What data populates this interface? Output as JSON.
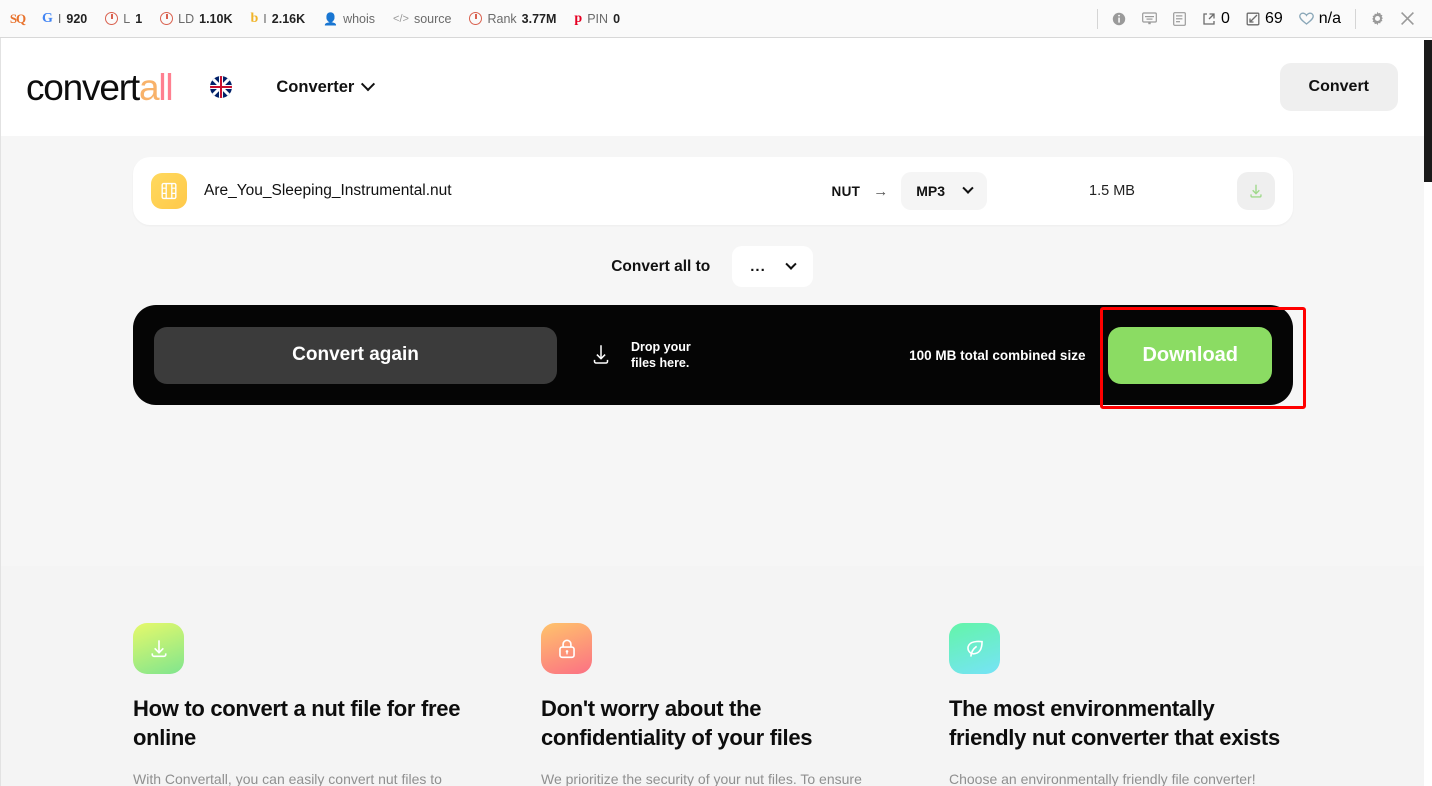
{
  "extension_toolbar": {
    "logo_text": "SQ",
    "metrics": [
      {
        "icon": "google-icon",
        "glyph": "G",
        "label": "I",
        "value": "920"
      },
      {
        "icon": "semrush-icon",
        "label": "L",
        "value": "1"
      },
      {
        "icon": "semrush-icon",
        "label": "LD",
        "value": "1.10K"
      },
      {
        "icon": "bing-icon",
        "label": "I",
        "value": "2.16K"
      },
      {
        "icon": "person-icon",
        "label": "whois",
        "value": ""
      },
      {
        "icon": "code-icon",
        "label": "source",
        "value": ""
      },
      {
        "icon": "semrush-icon",
        "label": "Rank",
        "value": "3.77M"
      },
      {
        "icon": "pinterest-icon",
        "label": "PIN",
        "value": "0"
      }
    ],
    "right_icons": [
      {
        "name": "info-icon"
      },
      {
        "name": "keyboard-icon"
      },
      {
        "name": "page-report-icon"
      }
    ],
    "right_stats": [
      {
        "icon": "external-link-icon",
        "value": "0"
      },
      {
        "icon": "internal-link-icon",
        "value": "69"
      },
      {
        "icon": "heart-icon",
        "value": "n/a"
      }
    ],
    "settings_icon": "gear-icon",
    "close_icon": "close-icon"
  },
  "header": {
    "logo": {
      "part1": "convert",
      "part2": "a",
      "part3": "ll"
    },
    "language_icon": "uk-flag-icon",
    "nav_label": "Converter",
    "nav_chevron": "chevron-down-icon",
    "convert_label": "Convert"
  },
  "converter": {
    "file_row": {
      "file_icon": "film-strip-icon",
      "filename": "Are_You_Sleeping_Instrumental.nut",
      "from_format": "NUT",
      "arrow": "→",
      "to_format": "MP3",
      "size": "1.5 MB",
      "download_icon": "download-icon"
    },
    "convert_all": {
      "label": "Convert all to",
      "value": "..."
    },
    "action_bar": {
      "convert_again_label": "Convert again",
      "drop_icon": "download-arrow-icon",
      "drop_line1": "Drop your",
      "drop_line2": "files here.",
      "combined_size": "100 MB total combined size",
      "download_label": "Download",
      "download_color": "#8BDC63"
    },
    "highlight_color": "#ff0000"
  },
  "features": [
    {
      "icon": "download-box-icon",
      "title": "How to convert a nut file for free online",
      "body": "With Convertall, you can easily convert nut files to"
    },
    {
      "icon": "lock-icon",
      "title": "Don't worry about the confidentiality of your files",
      "body": "We prioritize the security of your nut files. To ensure"
    },
    {
      "icon": "leaf-icon",
      "title": "The most environmentally friendly nut converter that exists",
      "body": "Choose an environmentally friendly file converter!"
    }
  ]
}
